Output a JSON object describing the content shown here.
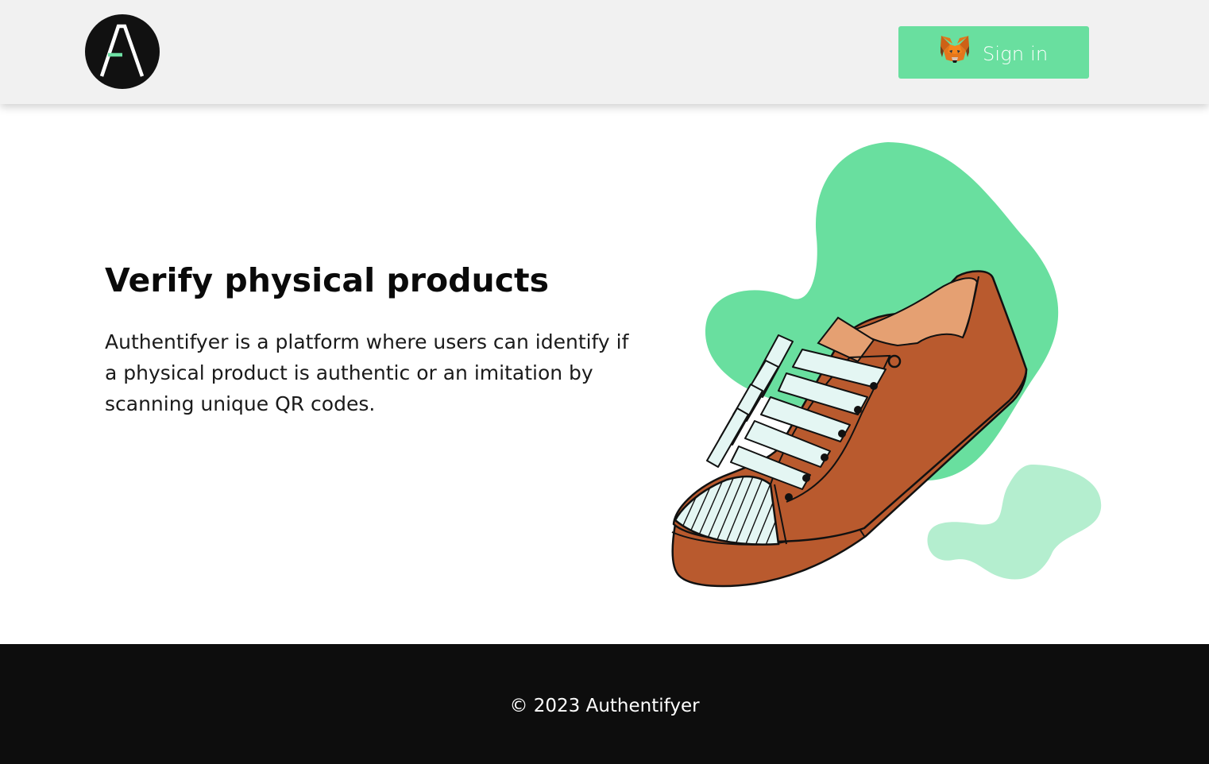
{
  "header": {
    "logo_icon": "authentifyer-a-logo-icon",
    "signin": {
      "label": "Sign in",
      "icon": "metamask-fox-icon"
    }
  },
  "hero": {
    "title": "Verify physical products",
    "description": "Authentifyer is a platform where users can identify if a physical product is authentic or an imitation by scanning unique QR codes.",
    "illustration_icon": "sneaker-illustration"
  },
  "footer": {
    "copyright": "© 2023 Authentifyer"
  },
  "colors": {
    "accent": "#69df9f",
    "accent_light": "#b4eecf",
    "header_bg": "#f1f1f1",
    "footer_bg": "#0d0d0d",
    "shoe": "#b95a2e",
    "shoe_inner": "#e5a072",
    "laces": "#e4f6f3"
  }
}
